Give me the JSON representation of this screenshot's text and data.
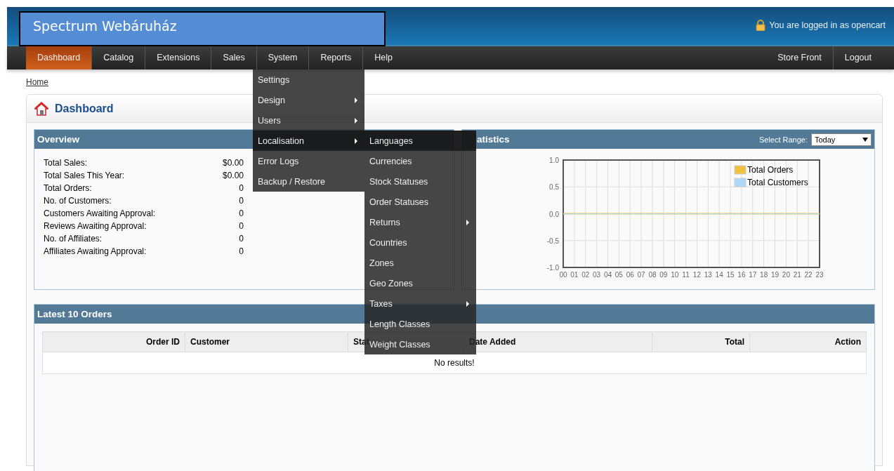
{
  "header": {
    "store_title": "Spectrum Webáruház",
    "login_status": "You are logged in as opencart"
  },
  "nav": {
    "items": [
      {
        "label": "Dashboard",
        "selected": true
      },
      {
        "label": "Catalog",
        "selected": false
      },
      {
        "label": "Extensions",
        "selected": false
      },
      {
        "label": "Sales",
        "selected": false
      },
      {
        "label": "System",
        "selected": false
      },
      {
        "label": "Reports",
        "selected": false
      },
      {
        "label": "Help",
        "selected": false
      }
    ],
    "right_items": [
      "Store Front",
      "Logout"
    ]
  },
  "system_menu": {
    "items": [
      {
        "label": "Settings",
        "has_submenu": false,
        "selected": false
      },
      {
        "label": "Design",
        "has_submenu": true,
        "selected": false
      },
      {
        "label": "Users",
        "has_submenu": true,
        "selected": false
      },
      {
        "label": "Localisation",
        "has_submenu": true,
        "selected": true
      },
      {
        "label": "Error Logs",
        "has_submenu": false,
        "selected": false
      },
      {
        "label": "Backup / Restore",
        "has_submenu": false,
        "selected": false
      }
    ]
  },
  "localisation_menu": {
    "items": [
      {
        "label": "Languages",
        "has_submenu": false,
        "selected": true
      },
      {
        "label": "Currencies",
        "has_submenu": false,
        "selected": false
      },
      {
        "label": "Stock Statuses",
        "has_submenu": false,
        "selected": false
      },
      {
        "label": "Order Statuses",
        "has_submenu": false,
        "selected": false
      },
      {
        "label": "Returns",
        "has_submenu": true,
        "selected": false
      },
      {
        "label": "Countries",
        "has_submenu": false,
        "selected": false
      },
      {
        "label": "Zones",
        "has_submenu": false,
        "selected": false
      },
      {
        "label": "Geo Zones",
        "has_submenu": false,
        "selected": false
      },
      {
        "label": "Taxes",
        "has_submenu": true,
        "selected": false
      },
      {
        "label": "Length Classes",
        "has_submenu": false,
        "selected": false
      },
      {
        "label": "Weight Classes",
        "has_submenu": false,
        "selected": false
      }
    ]
  },
  "breadcrumb": [
    "Home"
  ],
  "page_title": "Dashboard",
  "overview": {
    "title": "Overview",
    "rows": [
      {
        "label": "Total Sales:",
        "value": "$0.00"
      },
      {
        "label": "Total Sales This Year:",
        "value": "$0.00"
      },
      {
        "label": "Total Orders:",
        "value": "0"
      },
      {
        "label": "No. of Customers:",
        "value": "0"
      },
      {
        "label": "Customers Awaiting Approval:",
        "value": "0"
      },
      {
        "label": "Reviews Awaiting Approval:",
        "value": "0"
      },
      {
        "label": "No. of Affiliates:",
        "value": "0"
      },
      {
        "label": "Affiliates Awaiting Approval:",
        "value": "0"
      }
    ]
  },
  "statistics": {
    "title": "atistics",
    "range_label": "Select Range:",
    "range_value": "Today",
    "chart_data": {
      "type": "line",
      "grid": true,
      "legend": true,
      "x": [
        "00",
        "01",
        "02",
        "03",
        "04",
        "05",
        "06",
        "07",
        "08",
        "09",
        "10",
        "11",
        "12",
        "13",
        "14",
        "15",
        "16",
        "17",
        "18",
        "19",
        "20",
        "21",
        "22",
        "23"
      ],
      "ylim": [
        -1,
        1
      ],
      "yticks": [
        {
          "value": -1,
          "label": "-1.0"
        },
        {
          "value": -0.5,
          "label": "-0.5"
        },
        {
          "value": 0,
          "label": "0.0"
        },
        {
          "value": 0.5,
          "label": "0.5"
        },
        {
          "value": 1,
          "label": "1.0"
        }
      ],
      "series": [
        {
          "name": "Total Orders",
          "color": "#edc240",
          "values": [
            0,
            0,
            0,
            0,
            0,
            0,
            0,
            0,
            0,
            0,
            0,
            0,
            0,
            0,
            0,
            0,
            0,
            0,
            0,
            0,
            0,
            0,
            0,
            0
          ]
        },
        {
          "name": "Total Customers",
          "color": "#afd8f8",
          "values": [
            0,
            0,
            0,
            0,
            0,
            0,
            0,
            0,
            0,
            0,
            0,
            0,
            0,
            0,
            0,
            0,
            0,
            0,
            0,
            0,
            0,
            0,
            0,
            0
          ]
        }
      ]
    }
  },
  "latest_orders": {
    "title": "Latest 10 Orders",
    "columns": [
      "Order ID",
      "Customer",
      "Stat",
      "Date Added",
      "Total",
      "Action"
    ],
    "empty_message": "No results!"
  }
}
